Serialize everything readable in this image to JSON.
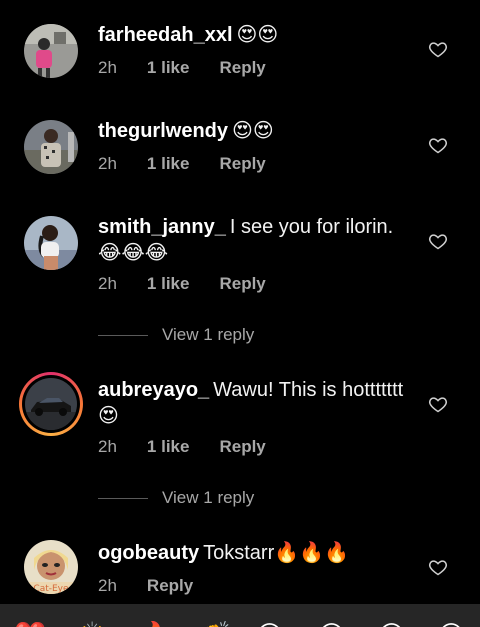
{
  "comments": [
    {
      "username": "farheedah_xxl",
      "text": "😍😍",
      "time": "2h",
      "likes": "1 like",
      "reply": "Reply"
    },
    {
      "username": "thegurlwendy",
      "text": "😍😍",
      "time": "2h",
      "likes": "1 like",
      "reply": "Reply"
    },
    {
      "username": "smith_janny_",
      "text": "I see you for ilorin. 😂😂😂",
      "time": "2h",
      "likes": "1 like",
      "reply": "Reply",
      "view_replies": "View 1 reply"
    },
    {
      "username": "aubreyayo_",
      "text": "Wawu! This is hottttttt😍",
      "time": "2h",
      "likes": "1 like",
      "reply": "Reply",
      "view_replies": "View 1 reply"
    },
    {
      "username": "ogobeauty",
      "text": "Tokstarr🔥🔥🔥",
      "time": "2h",
      "reply": "Reply",
      "avatar_caption": "Cat-Eye"
    }
  ],
  "emoji_bar": [
    "❤️",
    "🙌",
    "🔥",
    "👏",
    "😢",
    "😍",
    "😮",
    "😂"
  ],
  "colors": {
    "background": "#000000",
    "secondary_text": "#a8a8a8",
    "story_ring": "#e1306c",
    "emoji_bar_bg": "#262626"
  }
}
